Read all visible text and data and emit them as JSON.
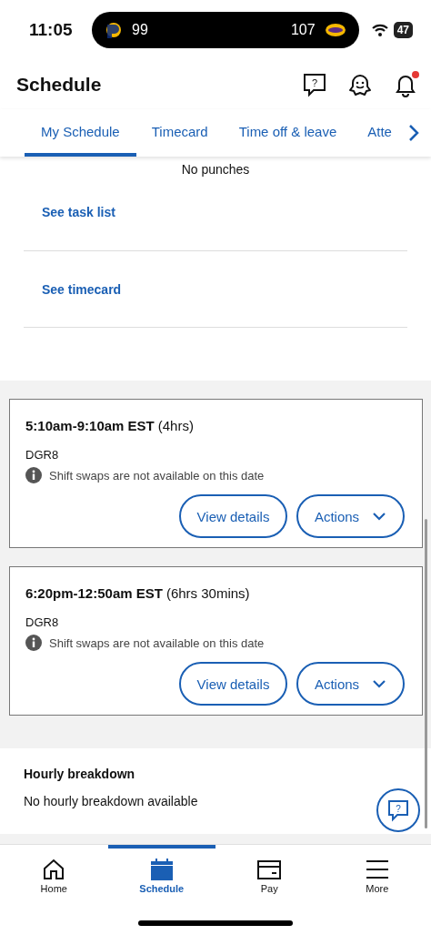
{
  "status_bar": {
    "time": "11:05",
    "live_activity": {
      "home_score": "99",
      "away_score": "107"
    },
    "battery": "47"
  },
  "header": {
    "title": "Schedule",
    "help_icon_glyph": "?",
    "notification_dot": true
  },
  "help_button": {
    "glyph": "?"
  },
  "tabs": [
    {
      "label": "My Schedule",
      "selected": true
    },
    {
      "label": "Timecard",
      "selected": false
    },
    {
      "label": "Time off & leave",
      "selected": false
    },
    {
      "label": "Atte",
      "selected": false
    }
  ],
  "punch_card": {
    "message": "No punches",
    "links": [
      "See task list",
      "See timecard"
    ]
  },
  "shifts": [
    {
      "time": "5:10am-9:10am EST",
      "duration": "(4hrs)",
      "site": "DGR8",
      "note": "Shift swaps are not available on this date",
      "buttons": [
        "View details",
        "Actions"
      ]
    },
    {
      "time": "6:20pm-12:50am EST",
      "duration": "(6hrs 30mins)",
      "site": "DGR8",
      "note": "Shift swaps are not available on this date",
      "buttons": [
        "View details",
        "Actions"
      ]
    }
  ],
  "hourly": {
    "title": "Hourly breakdown",
    "message": "No hourly breakdown available"
  },
  "bottom_nav": [
    {
      "label": "Home",
      "kind": "home",
      "selected": false
    },
    {
      "label": "Schedule",
      "kind": "calendar",
      "selected": true
    },
    {
      "label": "Pay",
      "kind": "card",
      "selected": false
    },
    {
      "label": "More",
      "kind": "menu",
      "selected": false
    }
  ]
}
